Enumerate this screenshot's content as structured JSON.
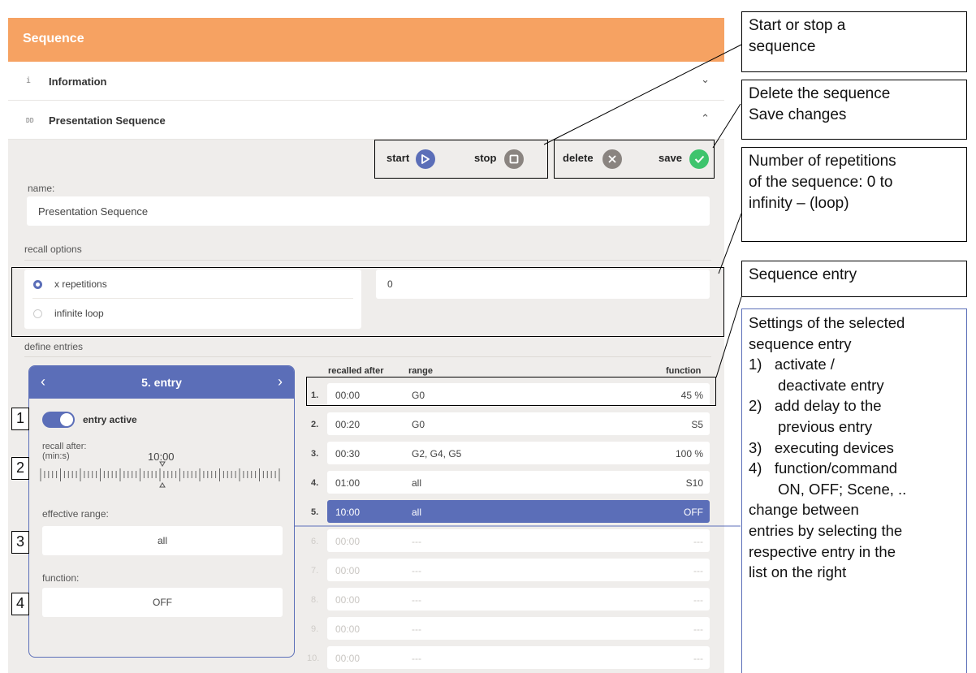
{
  "header": {
    "title": "Sequence"
  },
  "accordion": {
    "information": {
      "icon": "i",
      "label": "Information",
      "chevron": "⌄"
    },
    "presentation": {
      "icon": "DD",
      "label": "Presentation Sequence",
      "chevron": "⌃"
    }
  },
  "toolbar": {
    "start_label": "start",
    "stop_label": "stop",
    "delete_label": "delete",
    "save_label": "save"
  },
  "form": {
    "name_label": "name:",
    "name_value": "Presentation Sequence",
    "recall_label": "recall options",
    "opt_repetitions": "x repetitions",
    "opt_infinite": "infinite loop",
    "repetitions_value": "0",
    "define_label": "define entries"
  },
  "editor": {
    "title": "5. entry",
    "prev": "‹",
    "next": "›",
    "active_label": "entry active",
    "recall_label_1": "recall after:",
    "recall_label_2": "(min:s)",
    "recall_value": "10:00",
    "range_label": "effective range:",
    "range_value": "all",
    "function_label": "function:",
    "function_value": "OFF"
  },
  "table": {
    "headers": {
      "recalled": "recalled after",
      "range": "range",
      "function": "function"
    },
    "rows": [
      {
        "idx": "1.",
        "time": "00:00",
        "range": "G0",
        "function": "45 %"
      },
      {
        "idx": "2.",
        "time": "00:20",
        "range": "G0",
        "function": "S5"
      },
      {
        "idx": "3.",
        "time": "00:30",
        "range": "G2, G4, G5",
        "function": "100 %"
      },
      {
        "idx": "4.",
        "time": "01:00",
        "range": "all",
        "function": "S10"
      },
      {
        "idx": "5.",
        "time": "10:00",
        "range": "all",
        "function": "OFF"
      },
      {
        "idx": "6.",
        "time": "00:00",
        "range": "---",
        "function": "---"
      },
      {
        "idx": "7.",
        "time": "00:00",
        "range": "---",
        "function": "---"
      },
      {
        "idx": "8.",
        "time": "00:00",
        "range": "---",
        "function": "---"
      },
      {
        "idx": "9.",
        "time": "00:00",
        "range": "---",
        "function": "---"
      },
      {
        "idx": "10.",
        "time": "00:00",
        "range": "---",
        "function": "---"
      }
    ]
  },
  "callouts": {
    "start_stop": [
      "Start or stop a",
      "sequence"
    ],
    "delete_save": [
      "Delete the sequence",
      "Save changes"
    ],
    "repetitions": [
      "Number of repetitions",
      "of the sequence: 0  to",
      "infinity – (loop)"
    ],
    "entry": [
      "Sequence entry"
    ],
    "settings": [
      "Settings of the selected",
      "sequence entry",
      "1)   activate /",
      "       deactivate entry",
      "2)   add delay to the",
      "       previous entry",
      "3)   executing devices",
      "4)   function/command",
      "       ON, OFF; Scene, ..",
      "change between",
      "entries by selecting the",
      "respective entry in the",
      "list on the right"
    ]
  },
  "markers": [
    "1",
    "2",
    "3",
    "4"
  ],
  "colors": {
    "header": "#f6a262",
    "accent": "#5b6eb8",
    "save": "#3ec46d",
    "neutral_icon": "#8a8480"
  }
}
